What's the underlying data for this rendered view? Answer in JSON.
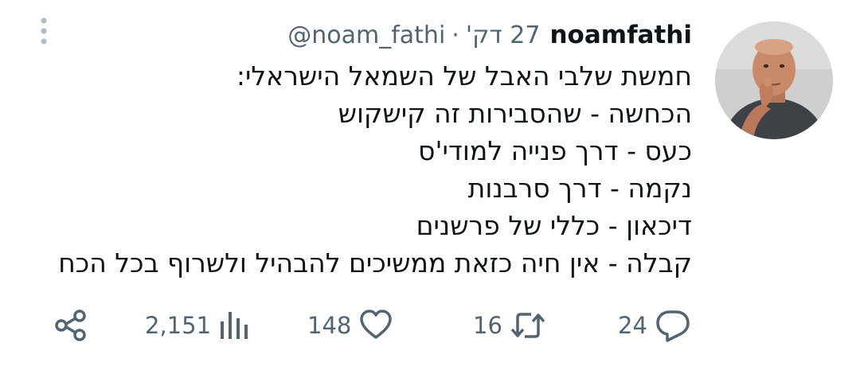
{
  "tweet": {
    "display_name": "noamfathi",
    "handle": "@noam_fathi",
    "separator": "·",
    "time": "27 דק'",
    "lines": [
      "חמשת שלבי האבל של השמאל הישראלי:",
      "הכחשה - שהסבירות זה קישקוש",
      "כעס - דרך פנייה למודי'ס",
      "נקמה - דרך סרבנות",
      "דיכאון - כללי של פרשנים",
      "קבלה - אין חיה כזאת ממשיכים להבהיל ולשרוף בכל הכח"
    ]
  },
  "actions": {
    "replies": "24",
    "retweets": "16",
    "likes": "148",
    "views": "2,151"
  },
  "icons": {
    "more": "more-vertical-icon",
    "reply": "speech-bubble-icon",
    "retweet": "retweet-icon",
    "like": "heart-icon",
    "views": "bar-chart-icon",
    "share": "share-icon"
  },
  "colors": {
    "text": "#0f1419",
    "secondary": "#536471",
    "more_dots": "#b4bcc4"
  }
}
